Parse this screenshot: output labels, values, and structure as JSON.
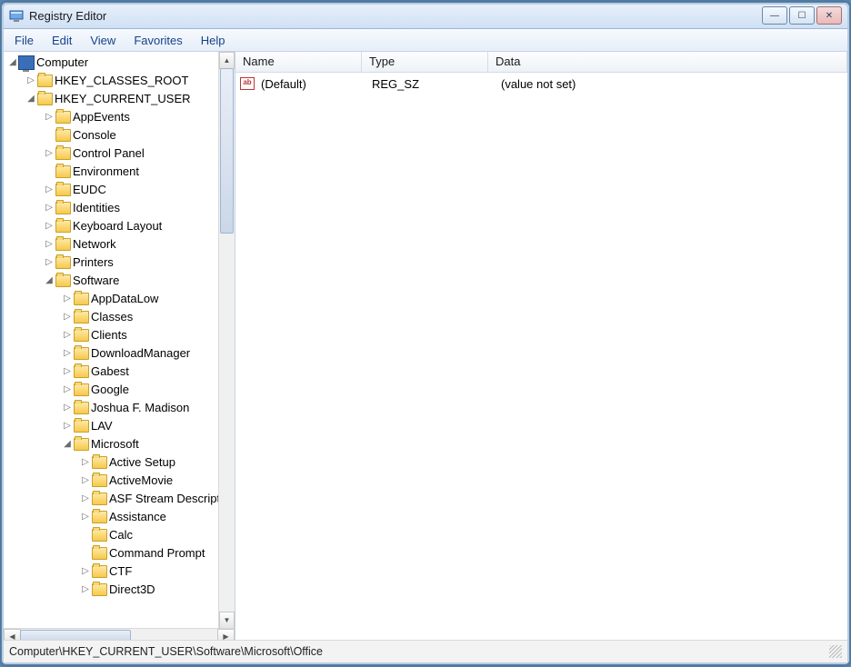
{
  "window": {
    "title": "Registry Editor"
  },
  "menu": {
    "file": "File",
    "edit": "Edit",
    "view": "View",
    "favorites": "Favorites",
    "help": "Help"
  },
  "tree": {
    "root": "Computer",
    "hkcr": "HKEY_CLASSES_ROOT",
    "hkcu": "HKEY_CURRENT_USER",
    "hkcu_children": {
      "appevents": "AppEvents",
      "console": "Console",
      "controlpanel": "Control Panel",
      "environment": "Environment",
      "eudc": "EUDC",
      "identities": "Identities",
      "keyboard": "Keyboard Layout",
      "network": "Network",
      "printers": "Printers",
      "software": "Software"
    },
    "software_children": {
      "appdatalow": "AppDataLow",
      "classes": "Classes",
      "clients": "Clients",
      "downloadmgr": "DownloadManager",
      "gabest": "Gabest",
      "google": "Google",
      "joshua": "Joshua F. Madison",
      "lav": "LAV",
      "microsoft": "Microsoft"
    },
    "microsoft_children": {
      "activesetup": "Active Setup",
      "activemovie": "ActiveMovie",
      "asf": "ASF Stream Descriptor",
      "assistance": "Assistance",
      "calc": "Calc",
      "cmd": "Command Prompt",
      "ctf": "CTF",
      "direct3d": "Direct3D"
    }
  },
  "list": {
    "headers": {
      "name": "Name",
      "type": "Type",
      "data": "Data"
    },
    "rows": [
      {
        "name": "(Default)",
        "type": "REG_SZ",
        "data": "(value not set)"
      }
    ]
  },
  "statusbar": {
    "path": "Computer\\HKEY_CURRENT_USER\\Software\\Microsoft\\Office"
  },
  "glyphs": {
    "collapsed": "▷",
    "expanded": "◢",
    "up": "▲",
    "down": "▼",
    "left": "◀",
    "right": "▶"
  }
}
